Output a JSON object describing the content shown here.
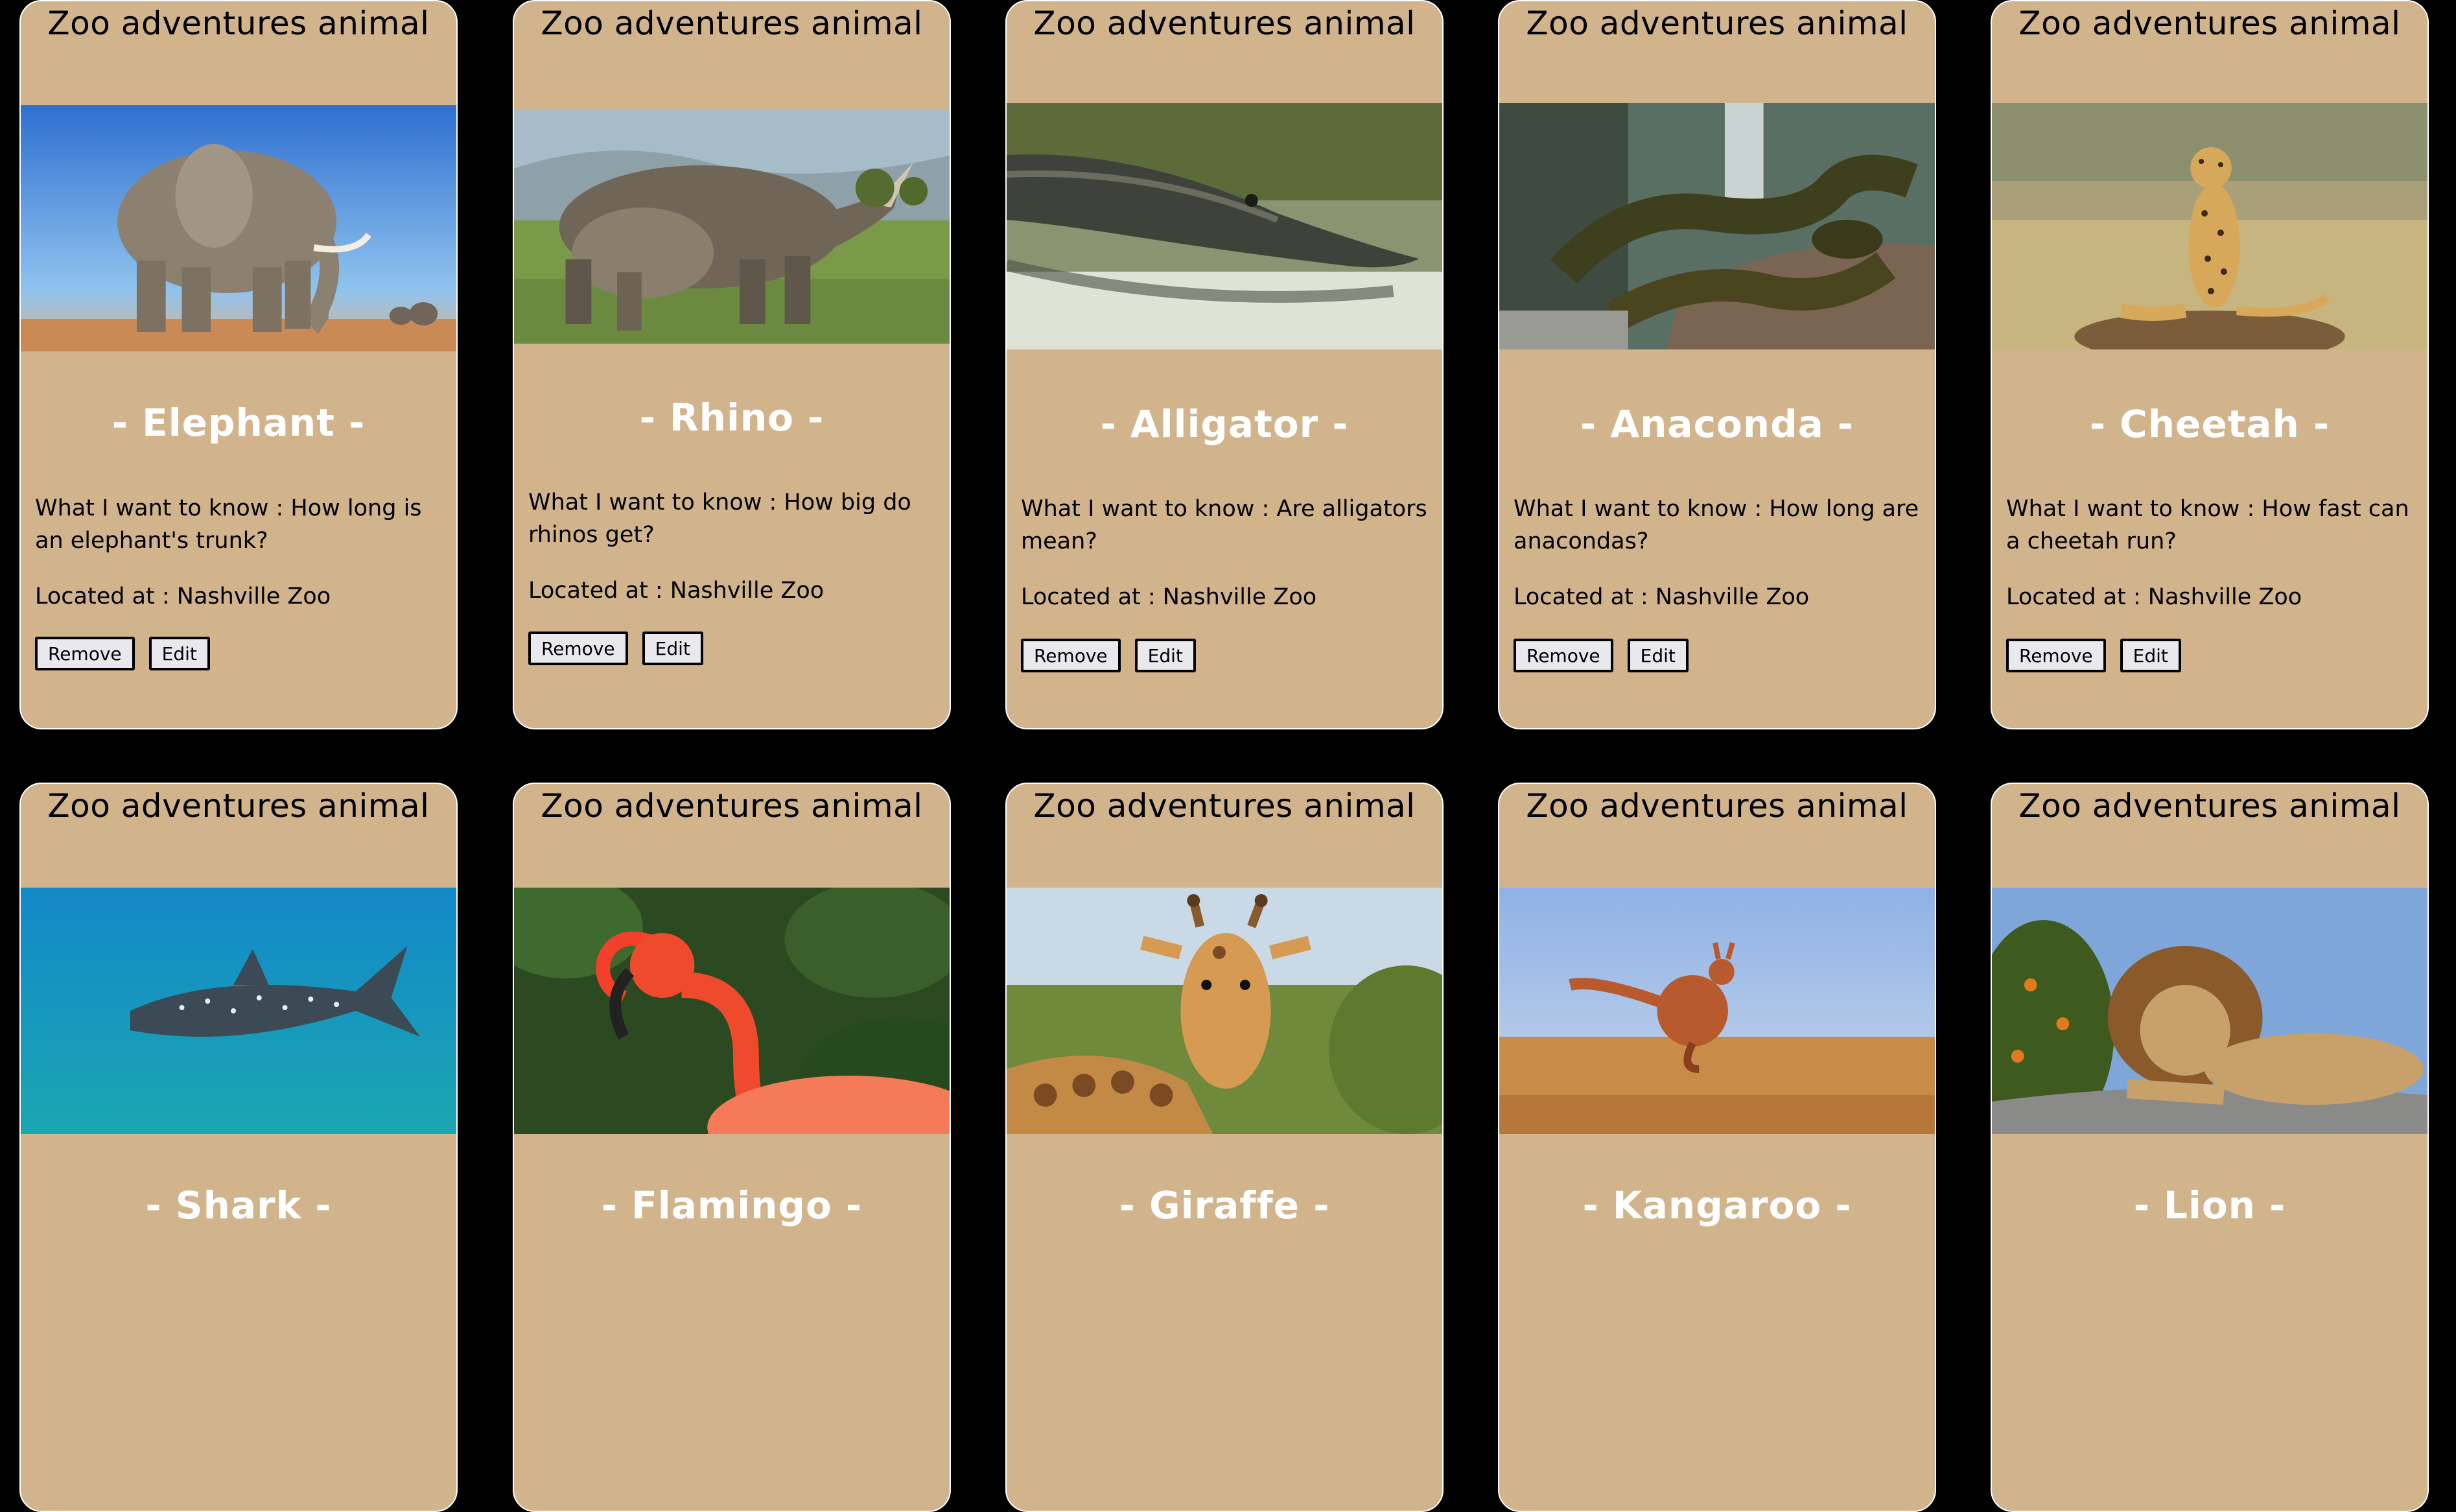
{
  "header_text": "Zoo adventures animal",
  "question_prefix": "What I want to know : ",
  "location_prefix": "Located at : ",
  "remove_label": "Remove",
  "edit_label": "Edit",
  "colors": {
    "page_background": "#000000",
    "card_background": "#d2b48c",
    "card_border": "#ffffff",
    "name_color": "#ffffff"
  },
  "animals": [
    {
      "name": "- Elephant -",
      "question": "What I want to know : How long is an elephant's trunk?",
      "location": "Located at : Nashville Zoo",
      "image_icon": "elephant-photo"
    },
    {
      "name": "- Rhino -",
      "question": "What I want to know : How big do rhinos get?",
      "location": "Located at : Nashville Zoo",
      "image_icon": "rhino-photo"
    },
    {
      "name": "- Alligator -",
      "question": "What I want to know : Are alligators mean?",
      "location": "Located at : Nashville Zoo",
      "image_icon": "alligator-photo"
    },
    {
      "name": "- Anaconda -",
      "question": "What I want to know : How long are anacondas?",
      "location": "Located at : Nashville Zoo",
      "image_icon": "anaconda-photo"
    },
    {
      "name": "- Cheetah -",
      "question": "What I want to know : How fast can a cheetah run?",
      "location": "Located at : Nashville Zoo",
      "image_icon": "cheetah-photo"
    },
    {
      "name": "- Shark -",
      "image_icon": "shark-photo"
    },
    {
      "name": "- Flamingo -",
      "image_icon": "flamingo-photo"
    },
    {
      "name": "- Giraffe -",
      "image_icon": "giraffe-photo"
    },
    {
      "name": "- Kangaroo -",
      "image_icon": "kangaroo-photo"
    },
    {
      "name": "- Lion -",
      "image_icon": "lion-photo"
    }
  ]
}
